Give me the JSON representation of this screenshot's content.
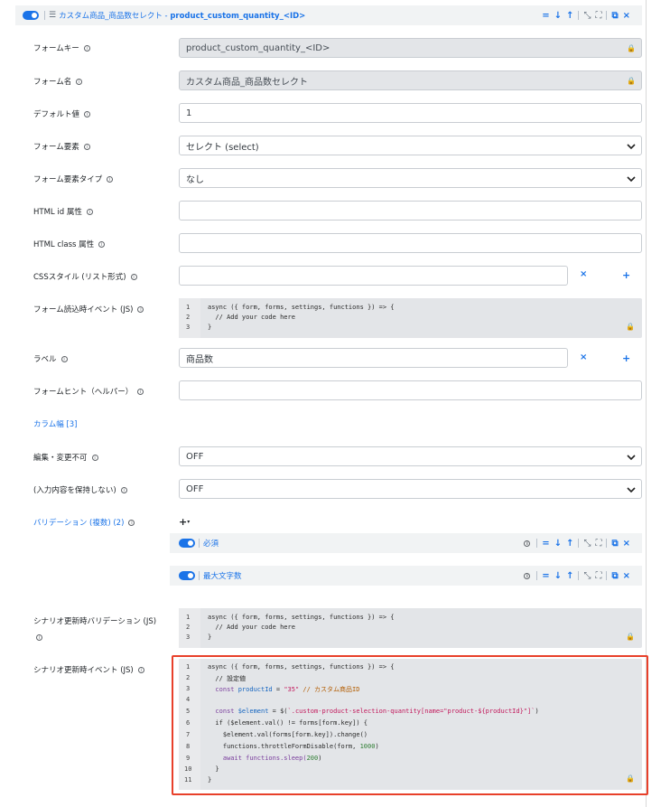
{
  "header": {
    "title_prefix": "カスタム商品_商品数セレクト - ",
    "title_key": "product_custom_quantity_<ID>"
  },
  "fields": {
    "form_key": {
      "label": "フォームキー",
      "value": "product_custom_quantity_<ID>"
    },
    "form_name": {
      "label": "フォーム名",
      "value": "カスタム商品_商品数セレクト"
    },
    "default_value": {
      "label": "デフォルト値",
      "value": "1"
    },
    "form_element": {
      "label": "フォーム要素",
      "value": "セレクト (select)"
    },
    "form_element_type": {
      "label": "フォーム要素タイプ",
      "value": "なし"
    },
    "html_id": {
      "label": "HTML id 属性",
      "value": ""
    },
    "html_class": {
      "label": "HTML class 属性",
      "value": ""
    },
    "css_style": {
      "label": "CSSスタイル (リスト形式)",
      "value": ""
    },
    "on_load_event": {
      "label": "フォーム読込時イベント (JS)"
    },
    "label": {
      "label": "ラベル",
      "value": "商品数"
    },
    "hint": {
      "label": "フォームヒント（ヘルパー）",
      "value": ""
    },
    "column_width": {
      "label": "カラム幅 [3]"
    },
    "edit_lock": {
      "label": "編集・変更不可",
      "value": "OFF"
    },
    "no_keep": {
      "label": "(入力内容を保持しない)",
      "value": "OFF"
    },
    "validation": {
      "label": "バリデーション (複数) (2)"
    },
    "scenario_validation": {
      "label": "シナリオ更新時バリデーション (JS)"
    },
    "scenario_event": {
      "label": "シナリオ更新時イベント (JS)"
    }
  },
  "validations": [
    {
      "name": "必須"
    },
    {
      "name": "最大文字数"
    }
  ],
  "code_default": {
    "lines": [
      "1",
      "2",
      "3"
    ],
    "line1": "async ({ form, forms, settings, functions }) => {",
    "line2": "  // Add your code here",
    "line3": "}"
  },
  "code_scenario": {
    "lines": [
      "1",
      "2",
      "3",
      "4",
      "5",
      "6",
      "7",
      "8",
      "9",
      "10",
      "11"
    ],
    "l1": "async ({ form, forms, settings, functions }) => {",
    "l2": "  // 設定値",
    "l3a": "  const ",
    "l3b": "productId",
    "l3c": " = ",
    "l3d": "\"35\"",
    "l3e": " // カスタム商品ID",
    "l4": "",
    "l5a": "  const ",
    "l5b": "$element",
    "l5c": " = $(",
    "l5d": "`.custom-product-selection-quantity[name=\"product-${productId}\"]`",
    "l5e": ")",
    "l6": "  if ($element.val() != forms[form.key]) {",
    "l7": "    $element.val(forms[form.key]).change()",
    "l8a": "    functions.throttleFormDisable(form, ",
    "l8b": "1000",
    "l8c": ")",
    "l9a": "    await functions.sleep(",
    "l9b": "200",
    "l9c": ")",
    "l10": "  }",
    "l11": "}"
  },
  "icons": {
    "info": "info-icon",
    "lock": "lock-icon",
    "remove": "close-icon",
    "add": "plus-icon"
  }
}
